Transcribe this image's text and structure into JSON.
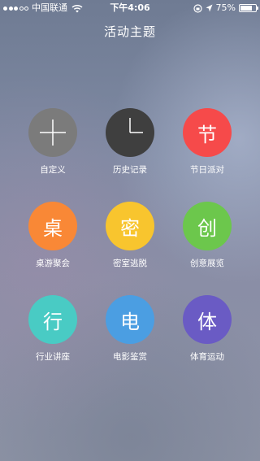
{
  "status_bar": {
    "carrier": "中国联通",
    "time": "下午4:06",
    "battery_percent": "75%",
    "battery_level": 0.75,
    "signal_bars_filled": 3,
    "signal_bars_total": 5
  },
  "header": {
    "title": "活动主题"
  },
  "themes": [
    {
      "label": "自定义",
      "glyph": "",
      "icon": "plus-icon",
      "color": "#7b7b7b"
    },
    {
      "label": "历史记录",
      "glyph": "",
      "icon": "clock-icon",
      "color": "#3f3f3f"
    },
    {
      "label": "节日派对",
      "glyph": "节",
      "icon": "festival-icon",
      "color": "#f64a4a"
    },
    {
      "label": "桌游聚会",
      "glyph": "桌",
      "icon": "boardgame-icon",
      "color": "#f98836"
    },
    {
      "label": "密室逃脱",
      "glyph": "密",
      "icon": "escape-room-icon",
      "color": "#f8c52e"
    },
    {
      "label": "创意展览",
      "glyph": "创",
      "icon": "exhibition-icon",
      "color": "#6cc74c"
    },
    {
      "label": "行业讲座",
      "glyph": "行",
      "icon": "lecture-icon",
      "color": "#49cbc4"
    },
    {
      "label": "电影鉴赏",
      "glyph": "电",
      "icon": "movie-icon",
      "color": "#4b9ee2"
    },
    {
      "label": "体育运动",
      "glyph": "体",
      "icon": "sports-icon",
      "color": "#6a5bc4"
    }
  ]
}
